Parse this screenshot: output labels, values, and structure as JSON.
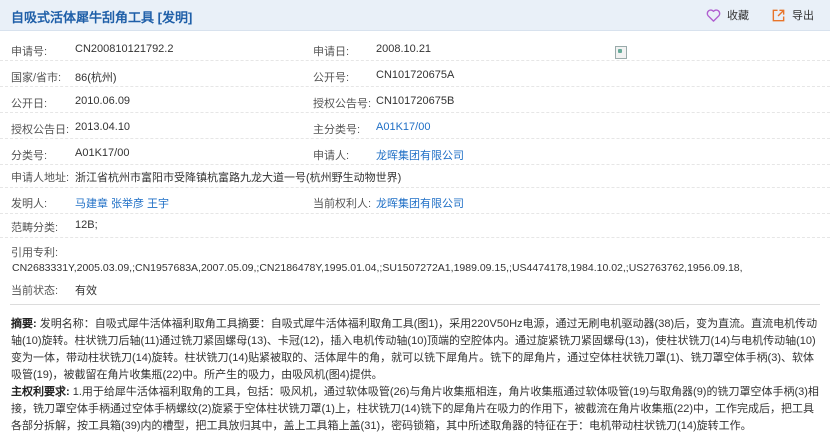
{
  "header": {
    "title": "自吸式活体犀牛刮角工具 [发明]",
    "favorite_label": "收藏",
    "export_label": "导出"
  },
  "fields": {
    "app_no_label": "申请号:",
    "app_no": "CN200810121792.2",
    "app_date_label": "申请日:",
    "app_date": "2008.10.21",
    "country_label": "国家/省市:",
    "country": "86(杭州)",
    "pub_no_label": "公开号:",
    "pub_no": "CN101720675A",
    "pub_date_label": "公开日:",
    "pub_date": "2010.06.09",
    "grant_no_label": "授权公告号:",
    "grant_no": "CN101720675B",
    "grant_date_label": "授权公告日:",
    "grant_date": "2013.04.10",
    "main_class_label": "主分类号:",
    "main_class": "A01K17/00",
    "class_label": "分类号:",
    "class_no": "A01K17/00",
    "applicant_label": "申请人:",
    "applicant": "龙晖集团有限公司",
    "address_label": "申请人地址:",
    "address": "浙江省杭州市富阳市受降镇杭富路九龙大道一号(杭州野生动物世界)",
    "inventor_label": "发明人:",
    "inventors": [
      "马建章",
      "张举彦",
      "王宇"
    ],
    "holder_label": "当前权利人:",
    "holder": "龙晖集团有限公司",
    "range_label": "范畴分类:",
    "range": "12B;",
    "cite_label": "引用专利:",
    "cites": "CN2683331Y,2005.03.09,;CN1957683A,2007.05.09,;CN2186478Y,1995.01.04,;SU1507272A1,1989.09.15,;US4474178,1984.10.02,;US2763762,1956.09.18,",
    "status_label": "当前状态:",
    "status": "有效"
  },
  "abstract": {
    "label": "摘要:",
    "text": "发明名称：自吸式犀牛活体福利取角工具摘要：自吸式犀牛活体福利取角工具(图1)，采用220V50Hz电源，通过无刷电机驱动器(38)后，变为直流。直流电机传动轴(10)旋转。柱状铣刀后轴(11)通过铣刀紧固螺母(13)、卡冠(12)，插入电机传动轴(10)顶端的空腔体内。通过旋紧铣刀紧固螺母(13)，使柱状铣刀(14)与电机传动轴(10)变为一体，带动柱状铣刀(14)旋转。柱状铣刀(14)贴紧被取的、活体犀牛的角，就可以铣下犀角片。铣下的犀角片，通过空体柱状铣刀罩(1)、铣刀罩空体手柄(3)、软体吸管(19)，被截留在角片收集瓶(22)中。所产生的吸力，由吸风机(图4)提供。"
  },
  "claims": {
    "label": "主权利要求:",
    "text": "1.用于给犀牛活体福利取角的工具，包括：吸风机，通过软体吸管(26)与角片收集瓶相连，角片收集瓶通过软体吸管(19)与取角器(9)的铣刀罩空体手柄(3)相接，铣刀罩空体手柄通过空体手柄螺纹(2)旋紧于空体柱状铣刀罩(1)上，柱状铣刀(14)铣下的犀角片在吸力的作用下，被截流在角片收集瓶(22)中，工作完成后，把工具各部分拆解，按工具箱(39)内的槽型，把工具放归其中，盖上工具箱上盖(31)，密码锁箱，其中所述取角器的特征在于：电机带动柱状铣刀(14)旋转工作。"
  }
}
